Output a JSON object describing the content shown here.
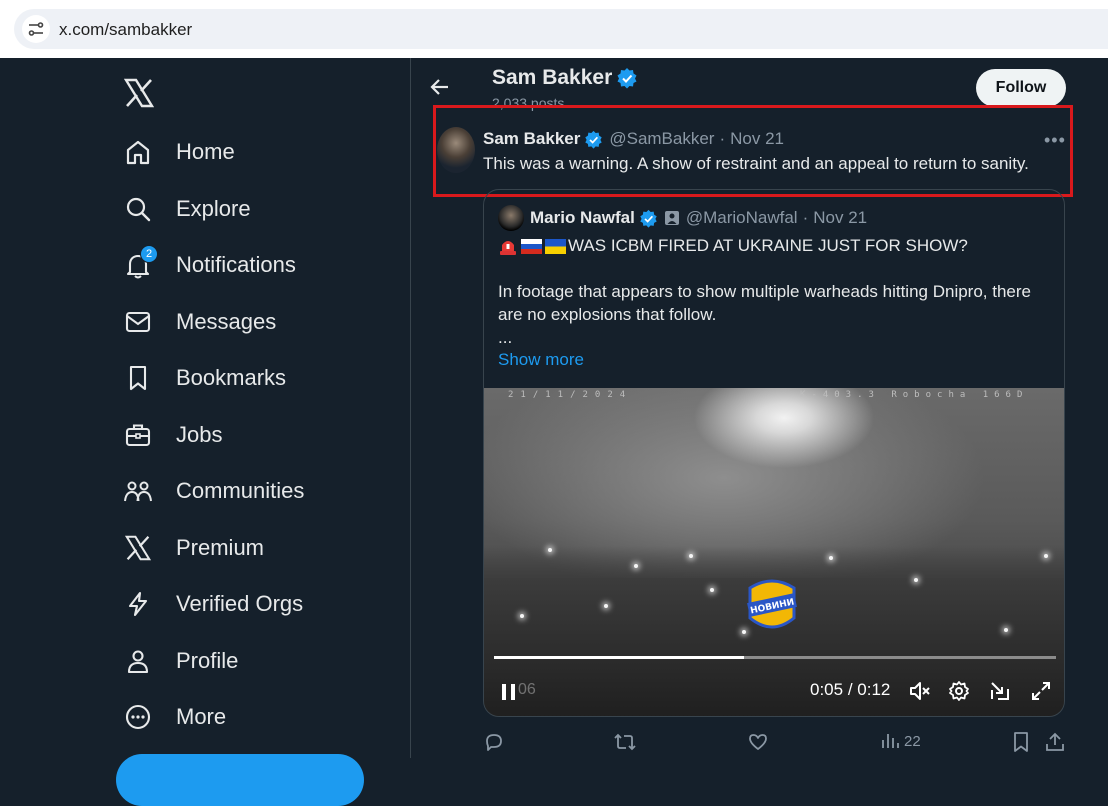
{
  "browser": {
    "url": "x.com/sambakker"
  },
  "nav": {
    "items": [
      {
        "label": "Home",
        "icon": "home-icon"
      },
      {
        "label": "Explore",
        "icon": "search-icon"
      },
      {
        "label": "Notifications",
        "icon": "bell-icon",
        "badge": "2"
      },
      {
        "label": "Messages",
        "icon": "envelope-icon"
      },
      {
        "label": "Bookmarks",
        "icon": "bookmark-icon"
      },
      {
        "label": "Jobs",
        "icon": "briefcase-icon"
      },
      {
        "label": "Communities",
        "icon": "people-icon"
      },
      {
        "label": "Premium",
        "icon": "x-logo-icon"
      },
      {
        "label": "Verified Orgs",
        "icon": "lightning-icon"
      },
      {
        "label": "Profile",
        "icon": "person-icon"
      },
      {
        "label": "More",
        "icon": "more-circle-icon"
      }
    ]
  },
  "header": {
    "name": "Sam Bakker",
    "posts": "2,033 posts",
    "follow_label": "Follow"
  },
  "tweet": {
    "name": "Sam Bakker",
    "handle": "@SamBakker",
    "sep": "·",
    "date": "Nov 21",
    "text": "This was a warning. A show of restraint and an appeal to return to sanity."
  },
  "quote": {
    "name": "Mario Nawfal",
    "handle": "@MarioNawfal",
    "sep": "·",
    "date": "Nov 21",
    "line1": "WAS ICBM FIRED AT UKRAINE JUST FOR SHOW?",
    "body": "In footage that appears to show multiple warheads hitting Dnipro, there are no explosions that follow.",
    "ellipsis": "...",
    "show_more": "Show more"
  },
  "video": {
    "timestamp_overlay": "21/11/2024",
    "camera_overlay": "K-403.3 Robocha 166D",
    "logo_text": "НОВИНИ",
    "current_time": "0:05",
    "duration": "0:12",
    "time_sep": " / ",
    "ghost_time": "06",
    "progress": 0.445
  },
  "actions": {
    "views": "22"
  },
  "colors": {
    "accent": "#1d9bf0",
    "background": "#15202b",
    "highlight_box": "#d9191c"
  }
}
